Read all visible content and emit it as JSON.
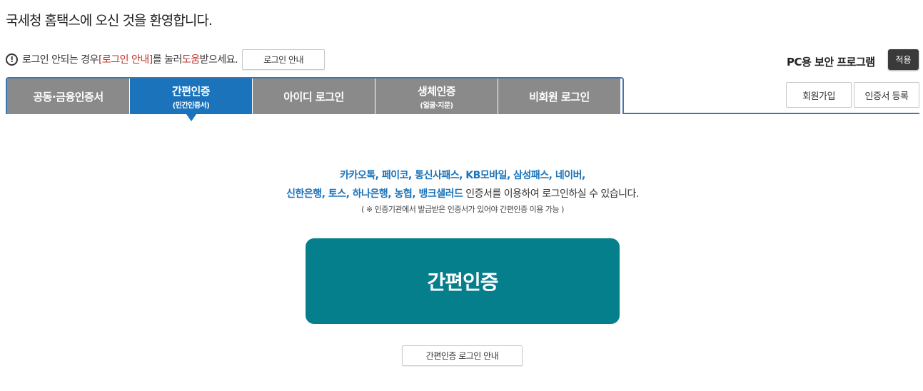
{
  "header": {
    "welcome": "국세청 홈택스에 오신 것을 환영합니다."
  },
  "notice": {
    "icon": "exclamation-circle-icon",
    "prefix": "로그인 안되는 경우 ",
    "link1": "[로그인 안내]",
    "middle": "를 눌러 ",
    "link2": "도움",
    "suffix": "받으세요.",
    "guide_button": "로그인 안내"
  },
  "security": {
    "label": "PC용 보안 프로그램",
    "apply_button": "적용"
  },
  "tabs": [
    {
      "label": "공동·금융인증서",
      "sub": ""
    },
    {
      "label": "간편인증",
      "sub": "(민간인증서)"
    },
    {
      "label": "아이디 로그인",
      "sub": ""
    },
    {
      "label": "생체인증",
      "sub": "(얼굴·지문)"
    },
    {
      "label": "비회원 로그인",
      "sub": ""
    }
  ],
  "actions": {
    "join": "회원가입",
    "cert_register": "인증서 등록"
  },
  "content": {
    "line1": "카카오톡, 페이코, 통신사패스, KB모바일, 삼성패스, 네이버,",
    "line2_blue": "신한은행, 토스, 하나은행, 농협, 뱅크샐러드",
    "line2_rest": " 인증서를 이용하여 로그인하실 수 있습니다.",
    "note": "( ※ 인증기관에서 발급받은 인증서가 있어야 간편인증 이용 가능 )",
    "main_button": "간편인증",
    "guide_button": "간편인증 로그인 안내"
  },
  "colors": {
    "active_tab": "#1a73bb",
    "inactive_tab": "#8a8a8a",
    "main_button": "#067f8c",
    "link_red": "#c0302a"
  }
}
